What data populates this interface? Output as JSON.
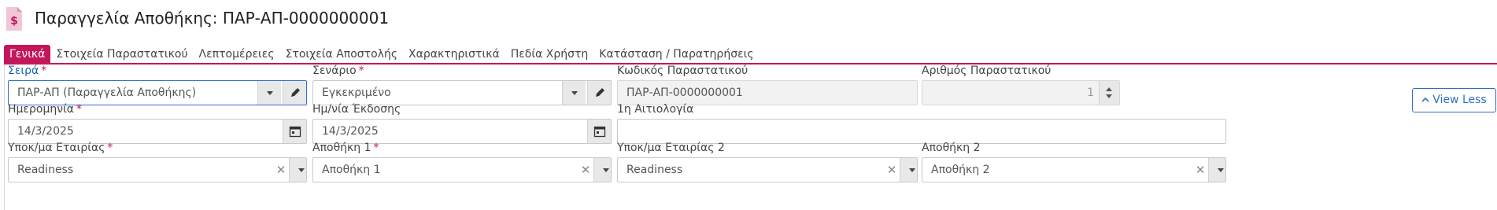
{
  "header": {
    "title": "Παραγγελία Αποθήκης: ΠΑΡ-ΑΠ-0000000001",
    "icon": "document-dollar-icon",
    "accent": "#c2185b"
  },
  "tabs": [
    {
      "label": "Γενικά",
      "active": true
    },
    {
      "label": "Στοιχεία Παραστατικού"
    },
    {
      "label": "Λεπτομέρειες"
    },
    {
      "label": "Στοιχεία Αποστολής"
    },
    {
      "label": "Χαρακτηριστικά"
    },
    {
      "label": "Πεδία Χρήστη"
    },
    {
      "label": "Κατάσταση / Παρατηρήσεις"
    }
  ],
  "form": {
    "series": {
      "label": "Σειρά",
      "required": "*",
      "value": "ΠΑΡ-ΑΠ (Παραγγελία Αποθήκης)"
    },
    "scenario": {
      "label": "Σενάριο",
      "required": "*",
      "value": "Εγκεκριμένο"
    },
    "doc_code": {
      "label": "Κωδικός Παραστατικού",
      "value": "ΠΑΡ-ΑΠ-0000000001"
    },
    "doc_number": {
      "label": "Αριθμός Παραστατικού",
      "value": "1"
    },
    "date": {
      "label": "Ημερομηνία",
      "required": "*",
      "value": "14/3/2025"
    },
    "issue_date": {
      "label": "Ημ/νία Έκδοσης",
      "value": "14/3/2025"
    },
    "reason1": {
      "label": "1η Αιτιολογία",
      "value": ""
    },
    "branch": {
      "label": "Υποκ/μα Εταιρίας",
      "required": "*",
      "value": "Readiness"
    },
    "warehouse1": {
      "label": "Αποθήκη 1",
      "required": "*",
      "value": "Αποθήκη 1"
    },
    "branch2": {
      "label": "Υποκ/μα Εταιρίας 2",
      "value": "Readiness"
    },
    "warehouse2": {
      "label": "Αποθήκη 2",
      "value": "Αποθήκη 2"
    }
  },
  "buttons": {
    "view_less": "View Less"
  },
  "icons": {
    "clear": "✕",
    "dropdown": "chevron-down-icon",
    "edit": "pencil-icon",
    "calendar": "calendar-icon",
    "stepper": "stepper-icon",
    "view_less_chevron": "chevron-up-icon"
  }
}
